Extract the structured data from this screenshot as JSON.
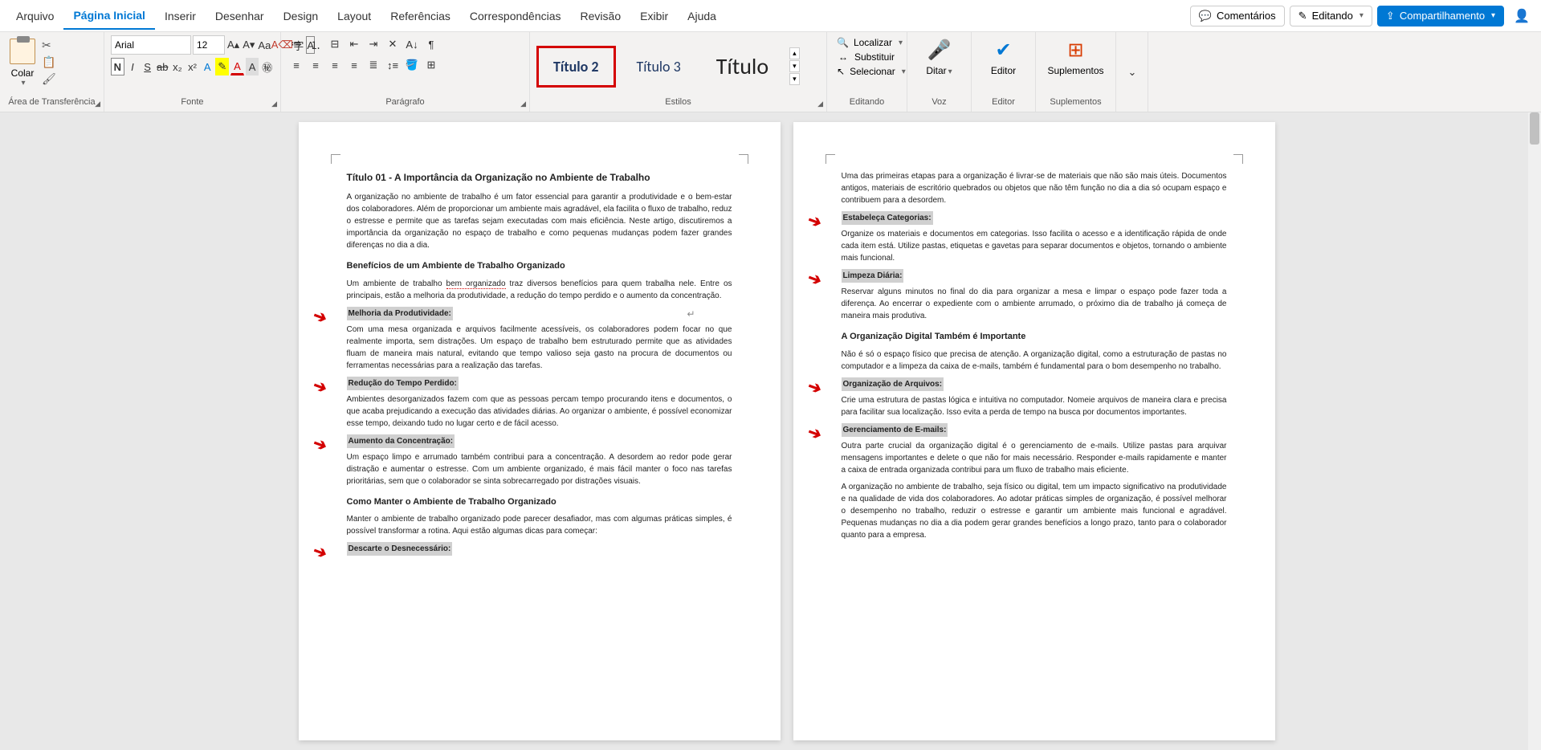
{
  "menu": {
    "arquivo": "Arquivo",
    "pagina_inicial": "Página Inicial",
    "inserir": "Inserir",
    "desenhar": "Desenhar",
    "design": "Design",
    "layout": "Layout",
    "referencias": "Referências",
    "correspondencias": "Correspondências",
    "revisao": "Revisão",
    "exibir": "Exibir",
    "ajuda": "Ajuda",
    "comentarios": "Comentários",
    "editando": "Editando",
    "compartilhamento": "Compartilhamento"
  },
  "ribbon": {
    "clipboard": {
      "paste": "Colar",
      "group": "Área de Transferência"
    },
    "font": {
      "name": "Arial",
      "size": "12",
      "group": "Fonte",
      "negrito": "N"
    },
    "para": {
      "group": "Parágrafo"
    },
    "styles": {
      "t2": "Título 2",
      "t3": "Título 3",
      "t": "Título",
      "group": "Estilos"
    },
    "editing": {
      "localizar": "Localizar",
      "substituir": "Substituir",
      "selecionar": "Selecionar",
      "group": "Editando"
    },
    "voice": {
      "ditar": "Ditar",
      "group": "Voz"
    },
    "editor": {
      "editor": "Editor",
      "group": "Editor"
    },
    "addins": {
      "suplementos": "Suplementos",
      "group": "Suplementos"
    }
  },
  "doc": {
    "page1": {
      "title": "Título 01 - A Importância da Organização no Ambiente de Trabalho",
      "p1": "A organização no ambiente de trabalho é um fator essencial para garantir a produtividade e o bem-estar dos colaboradores. Além de proporcionar um ambiente mais agradável, ela facilita o fluxo de trabalho, reduz o estresse e permite que as tarefas sejam executadas com mais eficiência. Neste artigo, discutiremos a importância da organização no espaço de trabalho e como pequenas mudanças podem fazer grandes diferenças no dia a dia.",
      "h2a": "Benefícios de um Ambiente de Trabalho Organizado",
      "p2a": "Um ambiente de trabalho ",
      "p2err": "bem organizado",
      "p2b": " traz diversos benefícios para quem trabalha nele. Entre os principais, estão a melhoria da produtividade, a redução do tempo perdido e o aumento da concentração.",
      "s1": "Melhoria da Produtividade:",
      "p3": "Com uma mesa organizada e arquivos facilmente acessíveis, os colaboradores podem focar no que realmente importa, sem distrações. Um espaço de trabalho bem estruturado permite que as atividades fluam de maneira mais natural, evitando que tempo valioso seja gasto na procura de documentos ou ferramentas necessárias para a realização das tarefas.",
      "s2": "Redução do Tempo Perdido:",
      "p4": "Ambientes desorganizados fazem com que as pessoas percam tempo procurando itens e documentos, o que acaba prejudicando a execução das atividades diárias. Ao organizar o ambiente, é possível economizar esse tempo, deixando tudo no lugar certo e de fácil acesso.",
      "s3": "Aumento da Concentração:",
      "p5": "Um espaço limpo e arrumado também contribui para a concentração. A desordem ao redor pode gerar distração e aumentar o estresse. Com um ambiente organizado, é mais fácil manter o foco nas tarefas prioritárias, sem que o colaborador se sinta sobrecarregado por distrações visuais.",
      "h2b": "Como Manter o Ambiente de Trabalho Organizado",
      "p6": "Manter o ambiente de trabalho organizado pode parecer desafiador, mas com algumas práticas simples, é possível transformar a rotina. Aqui estão algumas dicas para começar:",
      "s4": "Descarte o Desnecessário:"
    },
    "page2": {
      "p1": "Uma das primeiras etapas para a organização é livrar-se de materiais que não são mais úteis. Documentos antigos, materiais de escritório quebrados ou objetos que não têm função no dia a dia só ocupam espaço e contribuem para a desordem.",
      "s1": "Estabeleça Categorias:",
      "p2": "Organize os materiais e documentos em categorias. Isso facilita o acesso e a identificação rápida de onde cada item está. Utilize pastas, etiquetas e gavetas para separar documentos e objetos, tornando o ambiente mais funcional.",
      "s2": "Limpeza Diária:",
      "p3": " Reservar alguns minutos no final do dia para organizar a mesa e limpar o espaço pode fazer toda a diferença. Ao encerrar o expediente com o ambiente arrumado, o próximo dia de trabalho já começa de maneira mais produtiva.",
      "h2a": "A Organização Digital Também é Importante",
      "p4": "Não é só o espaço físico que precisa de atenção. A organização digital, como a estruturação de pastas no computador e a limpeza da caixa de e-mails, também é fundamental para o bom desempenho no trabalho.",
      "s3": "Organização de Arquivos:",
      "p5": "Crie uma estrutura de pastas lógica e intuitiva no computador. Nomeie arquivos de maneira clara e precisa para facilitar sua localização. Isso evita a perda de tempo na busca por documentos importantes.",
      "s4": "Gerenciamento de E-mails:",
      "p6": "Outra parte crucial da organização digital é o gerenciamento de e-mails. Utilize pastas para arquivar mensagens importantes e delete o que não for mais necessário. Responder e-mails rapidamente e manter a caixa de entrada organizada contribui para um fluxo de trabalho mais eficiente.",
      "p7": "A organização no ambiente de trabalho, seja físico ou digital, tem um impacto significativo na produtividade e na qualidade de vida dos colaboradores. Ao adotar práticas simples de organização, é possível melhorar o desempenho no trabalho, reduzir o estresse e garantir um ambiente mais funcional e agradável. Pequenas mudanças no dia a dia podem gerar grandes benefícios a longo prazo, tanto para o colaborador quanto para a empresa."
    }
  }
}
